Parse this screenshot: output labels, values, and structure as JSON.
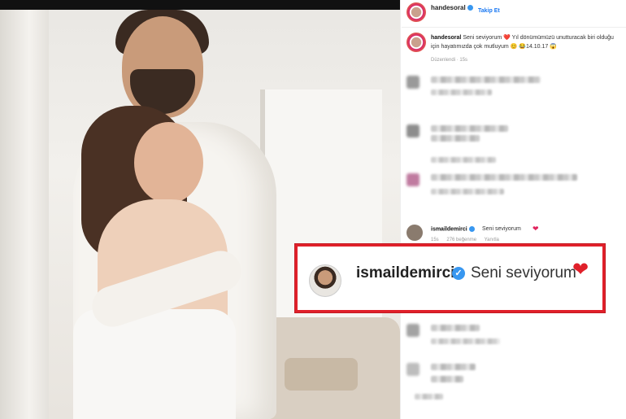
{
  "post_header": {
    "username": "handesoral",
    "verified": true,
    "follow_label": "Takip Et"
  },
  "caption": {
    "username": "handesoral",
    "text": "Seni seviyorum ❤️ Yıl dönümümüzü unutturacak biri olduğu için hayatımızda çok mutluyum 😊 😂14.10.17 😱",
    "meta": "Düzenlendi · 15s"
  },
  "comment": {
    "username": "ismaildemirci",
    "text": "Seni seviyorum",
    "heart": "❤",
    "age": "15s",
    "likes": "276 beğenme",
    "reply": "Yanıtla"
  },
  "highlight": {
    "username": "ismaildemirci",
    "verified_icon": "✓",
    "text": "Seni seviyorum",
    "heart": "❤"
  },
  "colors": {
    "highlight_border": "#e0202a",
    "follow_blue": "#1877f2",
    "verified_blue": "#3897f0",
    "heart_red": "#e0245e"
  }
}
